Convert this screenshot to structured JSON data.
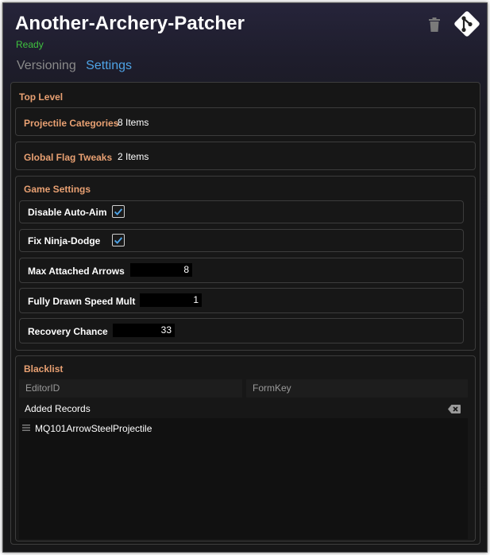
{
  "app": {
    "title": "Another-Archery-Patcher",
    "status": "Ready"
  },
  "tabs": [
    "Versioning",
    "Settings"
  ],
  "top_level": {
    "title": "Top Level",
    "projectile_categories": {
      "label": "Projectile Categories",
      "value": "8 Items"
    },
    "global_flag_tweaks": {
      "label": "Global Flag Tweaks",
      "value": "2 Items"
    }
  },
  "game_settings": {
    "title": "Game Settings",
    "disable_auto_aim": {
      "label": "Disable Auto-Aim",
      "checked": true
    },
    "fix_ninja_dodge": {
      "label": "Fix Ninja-Dodge",
      "checked": true
    },
    "max_attached_arrows": {
      "label": "Max Attached Arrows",
      "value": "8"
    },
    "fully_drawn_speed_mult": {
      "label": "Fully Drawn Speed Mult",
      "value": "1"
    },
    "recovery_chance": {
      "label": "Recovery Chance",
      "value": "33"
    }
  },
  "blacklist": {
    "title": "Blacklist",
    "editor_id_placeholder": "EditorID",
    "form_key_placeholder": "FormKey",
    "added_records_label": "Added Records",
    "records": [
      "MQ101ArrowSteelProjectile"
    ]
  },
  "colors": {
    "accent": "#4ea3e6",
    "section_title": "#e8a072",
    "status": "#3fc33f"
  }
}
